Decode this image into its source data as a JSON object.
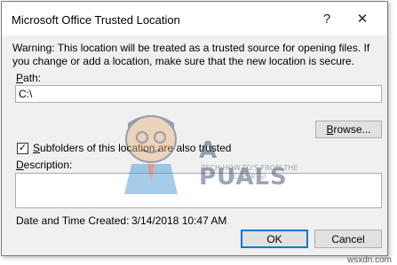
{
  "dialog": {
    "title": "Microsoft Office Trusted Location",
    "help_glyph": "?",
    "close_glyph": "✕"
  },
  "warning_text": "Warning: This location will be treated as a trusted source for opening files. If you change or add a location, make sure that the new location is secure.",
  "path": {
    "label_underlined": "P",
    "label_rest": "ath:",
    "value": "C:\\"
  },
  "browse_button": {
    "label_underlined": "B",
    "label_rest": "rowse..."
  },
  "subfolders": {
    "checked": true,
    "check_glyph": "✓",
    "label_underlined": "S",
    "label_rest": "ubfolders of this location are also trusted"
  },
  "description": {
    "label_underlined": "D",
    "label_rest": "escription:",
    "value": ""
  },
  "date_created": {
    "label": "Date and Time Created:",
    "value": "3/14/2018 10:47 AM"
  },
  "ok_button": {
    "label": "OK"
  },
  "cancel_button": {
    "label": "Cancel"
  },
  "watermark": {
    "brand": "A  PUALS",
    "tagline": "TECH HOW-TO'S FROM THE EXPERTS!"
  },
  "credit": "wsxdn.com",
  "colors": {
    "accent": "#0078d7",
    "dialog_bg": "#f0f0f0",
    "button_bg": "#e1e1e1"
  }
}
